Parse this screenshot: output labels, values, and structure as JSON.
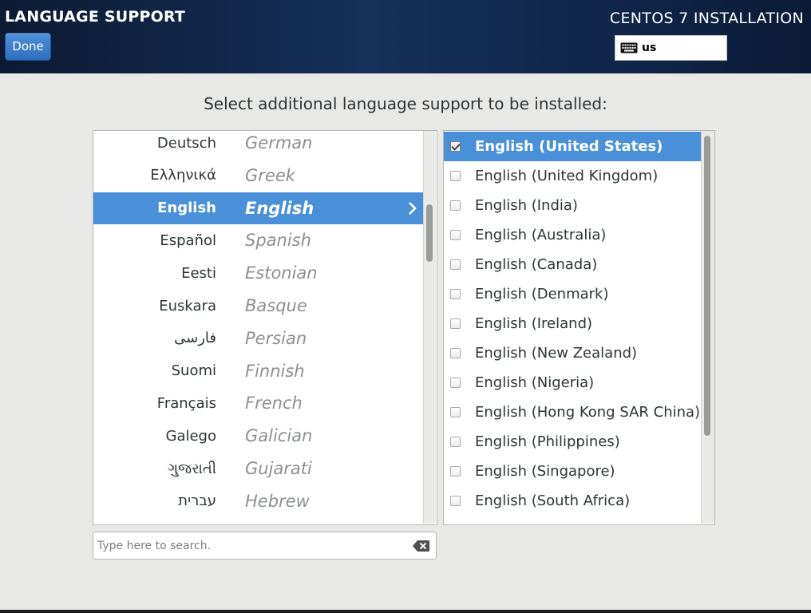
{
  "header": {
    "title": "LANGUAGE SUPPORT",
    "done_label": "Done",
    "product_title": "CENTOS 7 INSTALLATION",
    "keyboard_layout": "us"
  },
  "prompt": "Select additional language support to be installed:",
  "languages": [
    {
      "native": "Deutsch",
      "english": "German"
    },
    {
      "native": "Ελληνικά",
      "english": "Greek"
    },
    {
      "native": "English",
      "english": "English",
      "selected": true
    },
    {
      "native": "Español",
      "english": "Spanish"
    },
    {
      "native": "Eesti",
      "english": "Estonian"
    },
    {
      "native": "Euskara",
      "english": "Basque"
    },
    {
      "native": "فارسی",
      "english": "Persian"
    },
    {
      "native": "Suomi",
      "english": "Finnish"
    },
    {
      "native": "Français",
      "english": "French"
    },
    {
      "native": "Galego",
      "english": "Galician"
    },
    {
      "native": "ગુજરાતી",
      "english": "Gujarati"
    },
    {
      "native": "עברית",
      "english": "Hebrew"
    }
  ],
  "locales": [
    {
      "label": "English (United States)",
      "checked": true,
      "selected": true
    },
    {
      "label": "English (United Kingdom)",
      "checked": false
    },
    {
      "label": "English (India)",
      "checked": false
    },
    {
      "label": "English (Australia)",
      "checked": false
    },
    {
      "label": "English (Canada)",
      "checked": false
    },
    {
      "label": "English (Denmark)",
      "checked": false
    },
    {
      "label": "English (Ireland)",
      "checked": false
    },
    {
      "label": "English (New Zealand)",
      "checked": false
    },
    {
      "label": "English (Nigeria)",
      "checked": false
    },
    {
      "label": "English (Hong Kong SAR China)",
      "checked": false
    },
    {
      "label": "English (Philippines)",
      "checked": false
    },
    {
      "label": "English (Singapore)",
      "checked": false
    },
    {
      "label": "English (South Africa)",
      "checked": false
    }
  ],
  "search": {
    "placeholder": "Type here to search.",
    "value": ""
  },
  "colors": {
    "selection": "#4a90d9",
    "header_dark": "#0c1a33"
  }
}
